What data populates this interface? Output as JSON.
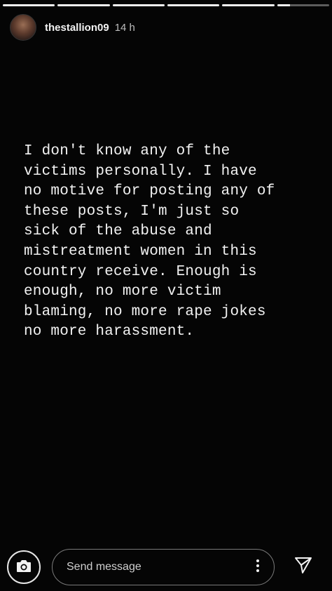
{
  "progress": {
    "segments": [
      1,
      1,
      1,
      1,
      1,
      0.25
    ]
  },
  "header": {
    "username": "thestallion09",
    "time": "14 h"
  },
  "story": {
    "text": "I don't know any of the\nvictims personally. I have\nno motive for posting any of\nthese posts, I'm just so\nsick of the abuse and\nmistreatment women in this\ncountry receive. Enough is\nenough, no more victim\nblaming, no more rape jokes\nno more harassment."
  },
  "footer": {
    "message_placeholder": "Send message",
    "icons": {
      "camera": "camera-icon",
      "more": "more-vertical-icon",
      "send": "send-icon"
    }
  },
  "colors": {
    "background": "#050505",
    "text": "#f2f2f2",
    "progress_fill": "#f2f2f2",
    "progress_track": "rgba(255,255,255,0.35)"
  }
}
